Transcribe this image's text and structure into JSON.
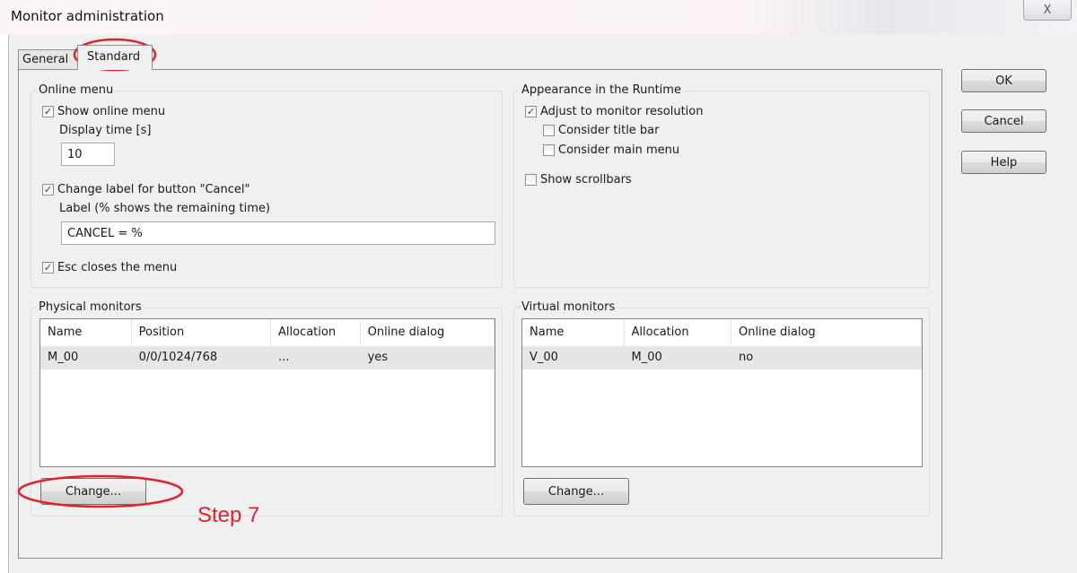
{
  "window": {
    "title": "Monitor administration",
    "close_glyph": "X"
  },
  "tabs": {
    "general": "General",
    "standard": "Standard"
  },
  "online_menu": {
    "legend": "Online menu",
    "show_online_menu": {
      "label": "Show online menu",
      "checked": true
    },
    "display_time_label": "Display time [s]",
    "display_time_value": "10",
    "change_label_cancel": {
      "label": "Change label for button \"Cancel\"",
      "checked": true
    },
    "label_hint": "Label (% shows the remaining time)",
    "label_value": "CANCEL = %",
    "esc_closes": {
      "label": "Esc closes the menu",
      "checked": true
    }
  },
  "appearance": {
    "legend": "Appearance in the Runtime",
    "adjust_resolution": {
      "label": "Adjust to monitor resolution",
      "checked": true
    },
    "consider_title_bar": {
      "label": "Consider title bar",
      "checked": false
    },
    "consider_main_menu": {
      "label": "Consider main menu",
      "checked": false
    },
    "show_scrollbars": {
      "label": "Show scrollbars",
      "checked": false
    }
  },
  "physical_monitors": {
    "legend": "Physical monitors",
    "columns": [
      "Name",
      "Position",
      "Allocation",
      "Online dialog"
    ],
    "rows": [
      [
        "M_00",
        "0/0/1024/768",
        "...",
        "yes"
      ]
    ],
    "change_label": "Change..."
  },
  "virtual_monitors": {
    "legend": "Virtual monitors",
    "columns": [
      "Name",
      "Allocation",
      "Online dialog"
    ],
    "rows": [
      [
        "V_00",
        "M_00",
        "no"
      ]
    ],
    "change_label": "Change..."
  },
  "buttons": {
    "ok": "OK",
    "cancel": "Cancel",
    "help": "Help"
  },
  "annotation": {
    "step_text": "Step 7",
    "color": "#e5202a"
  },
  "check_glyph": "✓"
}
